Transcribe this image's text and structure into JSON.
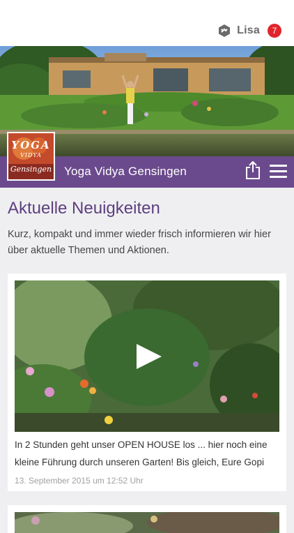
{
  "header": {
    "user_name": "Lisa",
    "notification_count": "7",
    "user_icon": "hexagon-logo-icon"
  },
  "brand": {
    "title": "Yoga Vidya Gensingen",
    "logo_text_top": "YOGA",
    "logo_text_small": "VIDYA",
    "logo_text_bottom": "Gensingen",
    "accent_color": "#6a4a8c",
    "badge_color": "#e0262c"
  },
  "news": {
    "title": "Aktuelle Neuigkeiten",
    "intro": "Kurz, kompakt und immer wieder frisch informieren wir hier über aktuelle Themen und Aktionen.",
    "posts": [
      {
        "text": "In 2 Stunden geht unser OPEN HOUSE los ... hier noch eine kleine Führung durch unseren Garten! Bis gleich, Eure Gopi",
        "date": "13. September 2015 um 12:52 Uhr",
        "media": "video"
      }
    ]
  }
}
